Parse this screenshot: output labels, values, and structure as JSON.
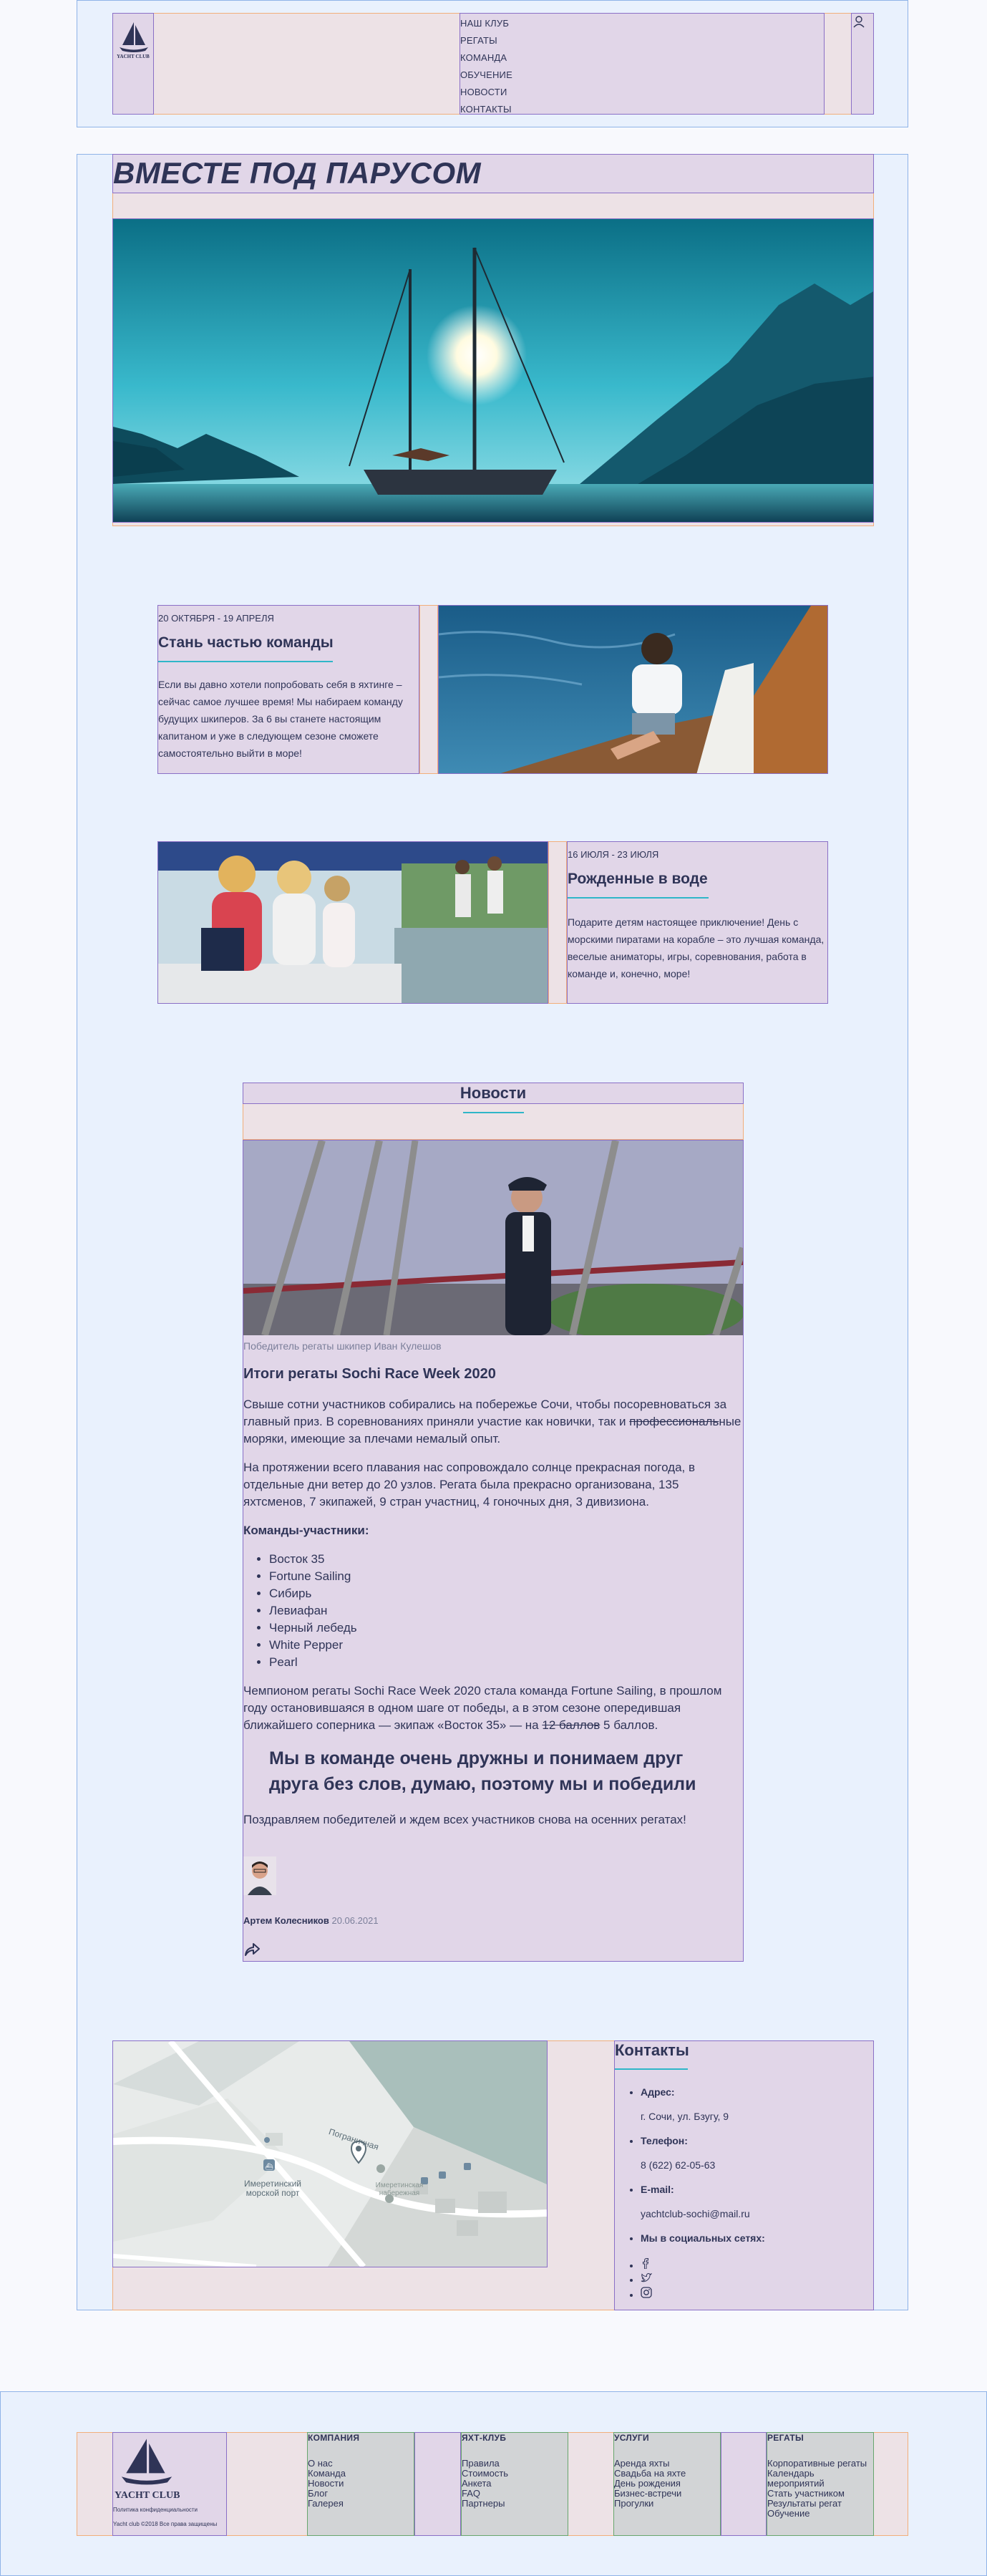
{
  "header": {
    "logo_text": "YACHT CLUB",
    "nav": [
      "НАШ КЛУБ",
      "РЕГАТЫ",
      "КОМАНДА",
      "ОБУЧЕНИЕ",
      "НОВОСТИ",
      "КОНТАКТЫ"
    ],
    "user_icon": "user-icon"
  },
  "hero": {
    "title": "ВМЕСТЕ ПОД ПАРУСОМ"
  },
  "events": [
    {
      "date": "20 ОКТЯБРЯ - 19 АПРЕЛЯ",
      "title": "Стань частью команды",
      "text": "Если вы давно хотели попробовать себя в яхтинге – сейчас самое лучшее время! Мы набираем команду будущих шкиперов. За 6 вы станете настоящим капитаном и уже в следующем сезоне сможете самостоятельно выйти в море!"
    },
    {
      "date": "16 ИЮЛЯ - 23 ИЮЛЯ",
      "title": "Рожденные в воде",
      "text": "Подарите детям настоящее приключение! День с морскими пиратами на корабле – это лучшая команда, веселые аниматоры, игры, соревнования, работа в команде и, конечно, море!"
    }
  ],
  "news": {
    "heading": "Новости",
    "caption": "Победитель регаты шкипер Иван Кулешов",
    "title": "Итоги регаты Sochi Race Week 2020",
    "p1_a": "Свыше сотни участников собирались на побережье Сочи, чтобы посоревноваться за главный приз. В соревнованиях приняли участие как новички, так и ",
    "p1_strike": "профессиональ",
    "p1_b": "ные моряки, имеющие за плечами немалый опыт.",
    "p2": "На протяжении всего плавания нас сопровождало солнце прекрасная погода, в отдельные дни ветер до 20 узлов. Регата была прекрасно организована, 135 яхтсменов, 7 экипажей, 9 стран участниц, 4 гоночных дня, 3 дивизиона.",
    "teams_heading": "Команды-участники:",
    "teams": [
      "Восток 35",
      "Fortune Sailing",
      "Сибирь",
      "Левиафан",
      "Черный лебедь",
      "White Pepper",
      "Pearl"
    ],
    "p3_a": "Чемпионом регаты Sochi Race Week 2020 стала команда Fortune Sailing, в прошлом году остановившаяся в одном шаге от победы, а в этом сезоне опередившая ближайшего соперника — экипаж «Восток 35» — на ",
    "p3_strike": "12 баллов",
    "p3_b": " 5 баллов.",
    "quote": "Мы в команде очень дружны и понимаем друг друга без слов, думаю, поэтому мы и победили",
    "p4": "Поздравляем победителей и ждем всех участников снова на осенних регатах!",
    "author": "Артем Колесников",
    "date": "20.06.2021"
  },
  "map": {
    "label_1": "Имеретинский морской порт",
    "label_2": "Пограничная",
    "label_3": "Имеретинская набережная"
  },
  "contacts": {
    "title": "Контакты",
    "address_label": "Адрес:",
    "address": "г. Сочи, ул. Бзугу, 9",
    "phone_label": "Телефон:",
    "phone": "8 (622) 62-05-63",
    "email_label": "E-mail:",
    "email": "yachtclub-sochi@mail.ru",
    "social_label": "Мы в социальных сетях:"
  },
  "footer": {
    "logo_text": "YACHT CLUB",
    "privacy": "Политика конфиденциальности",
    "copyright": "Yacht club ©2018 Все права защищены",
    "columns": [
      {
        "title": "КОМПАНИЯ",
        "items": [
          "О нас",
          "Команда",
          "Новости",
          "Блог",
          "Галерея"
        ]
      },
      {
        "title": "ЯХТ-КЛУБ",
        "items": [
          "Правила",
          "Стоимость",
          "Анкета",
          "FAQ",
          "Партнеры"
        ]
      },
      {
        "title": "УСЛУГИ",
        "items": [
          "Аренда яхты",
          "Свадьба на яхте",
          "День рождения",
          "Бизнес-встречи",
          "Прогулки"
        ]
      },
      {
        "title": "РЕГАТЫ",
        "items": [
          "Корпоративные регаты",
          "Календарь мероприятий",
          "Стать участником",
          "Результаты регат",
          "Обучение"
        ]
      }
    ]
  }
}
